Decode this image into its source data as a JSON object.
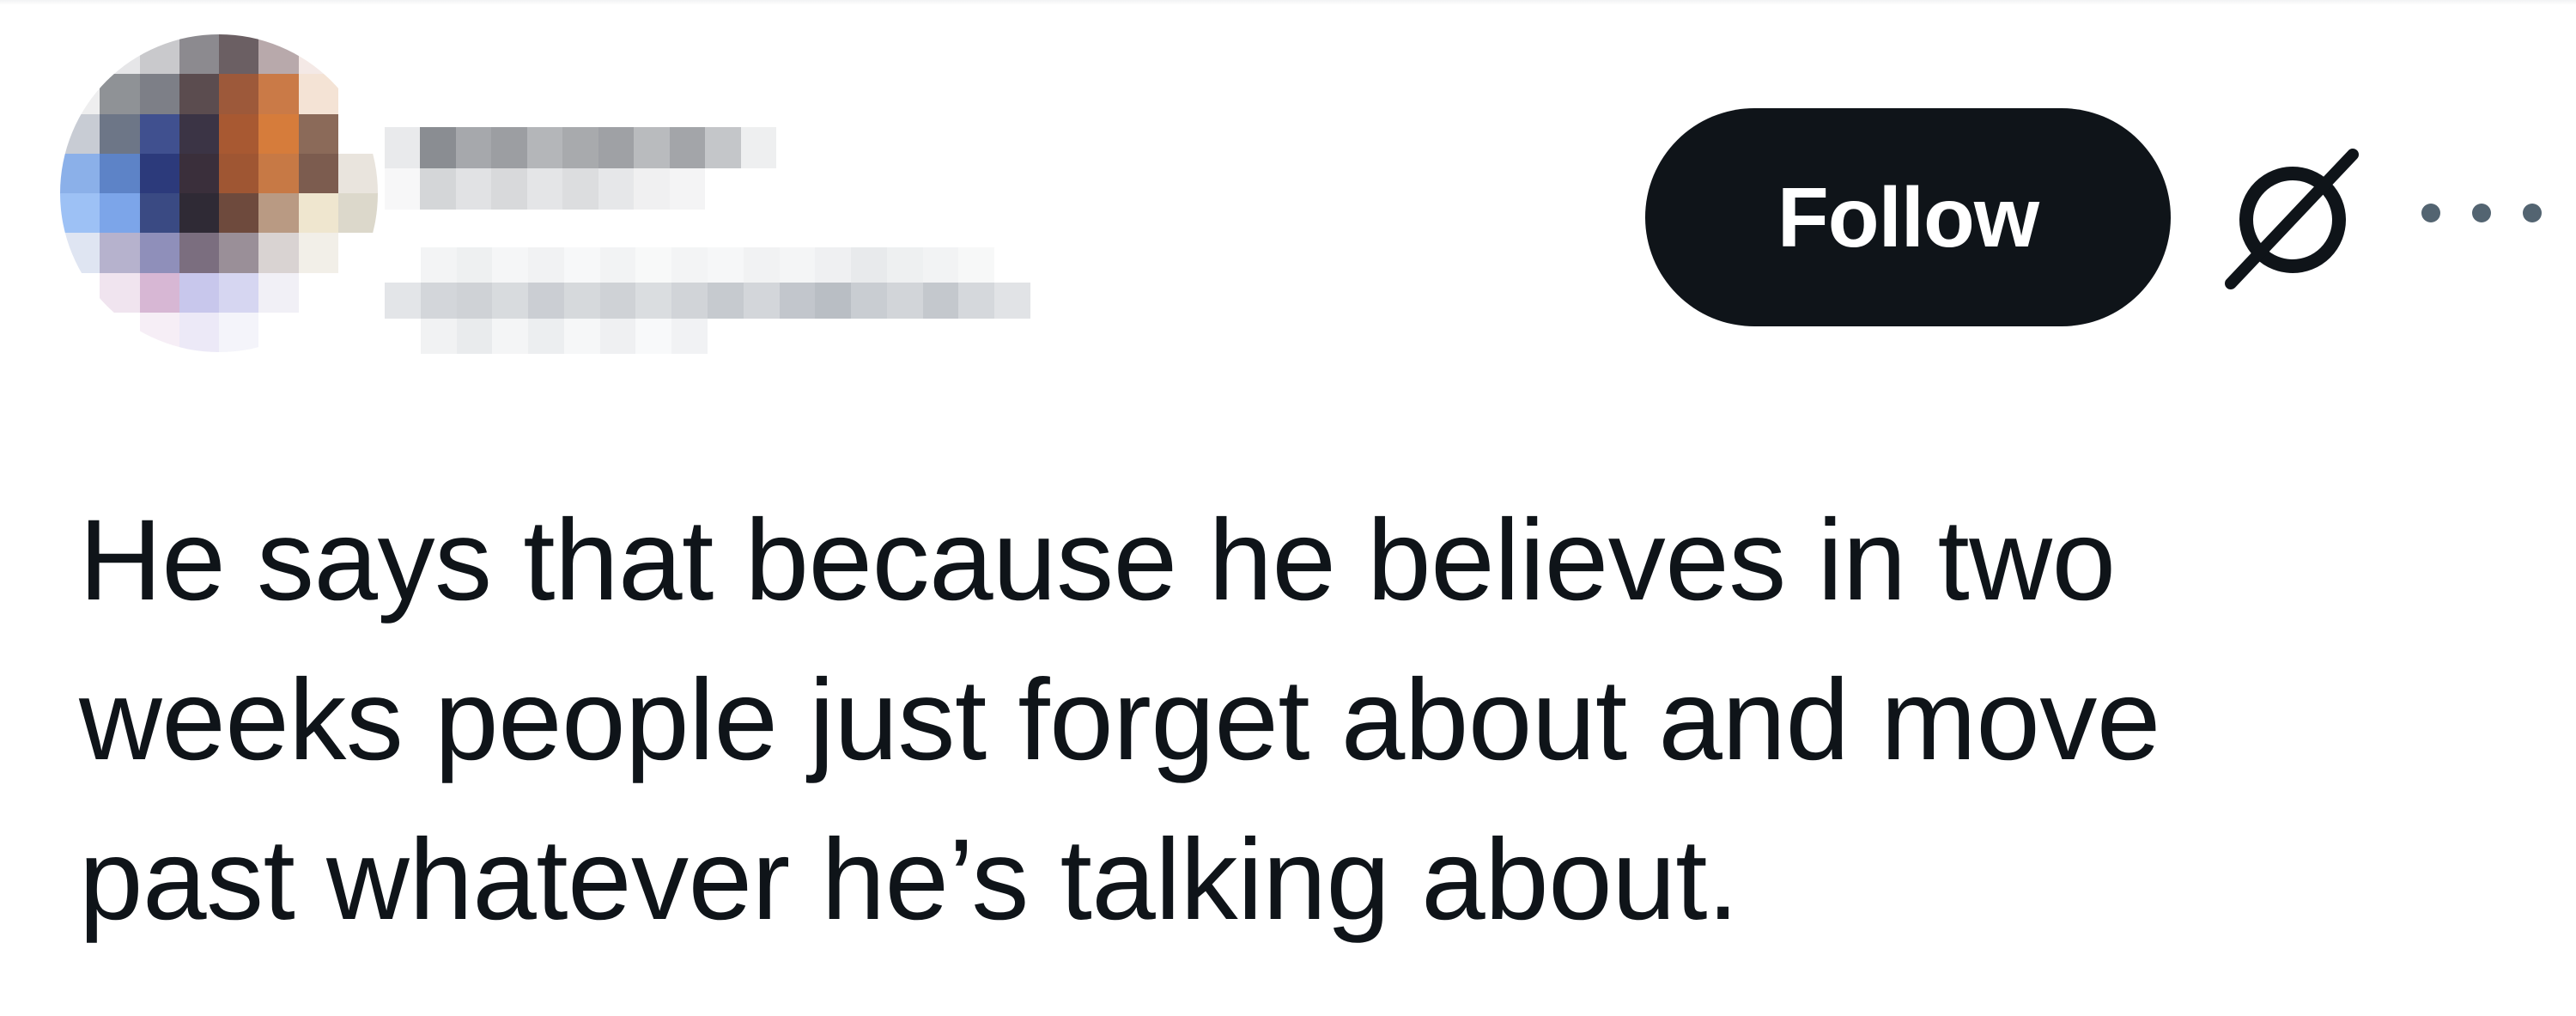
{
  "post": {
    "author": {
      "display_name": "",
      "handle": "",
      "avatar_censored": true
    },
    "actions": {
      "follow_label": "Follow",
      "grok_icon": "grok-icon",
      "more_icon": "more-icon"
    },
    "text_lines": [
      "He says that because he believes in two",
      "weeks people just forget about and move",
      "past whatever he’s talking about."
    ]
  },
  "colors": {
    "text": "#0f1419",
    "follow_bg": "#0f1419",
    "follow_text": "#ffffff",
    "secondary": "#536471",
    "background": "#ffffff"
  }
}
